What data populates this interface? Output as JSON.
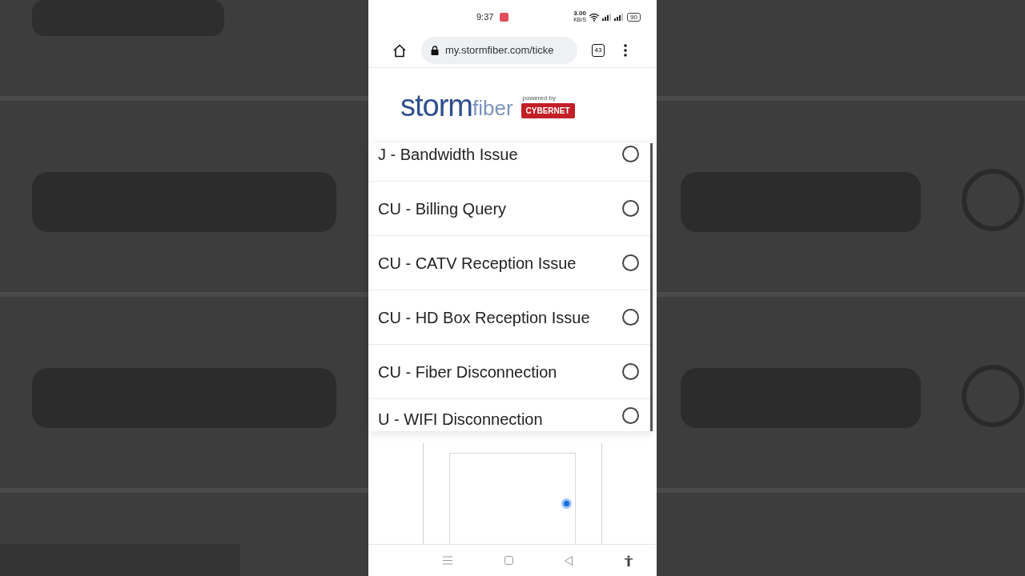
{
  "status_bar": {
    "time": "9:37",
    "network_speed": "3.00",
    "speed_unit": "KB/S",
    "battery": "90"
  },
  "browser": {
    "url": "my.stormfiber.com/ticke",
    "tab_count": "43"
  },
  "logo": {
    "brand": "storm",
    "suffix": "fiber",
    "powered_by": "powered by",
    "partner": "CYBERNET"
  },
  "options": [
    {
      "label": "J - Bandwidth Issue",
      "selected": false
    },
    {
      "label": "CU - Billing Query",
      "selected": false
    },
    {
      "label": "CU - CATV Reception Issue",
      "selected": false
    },
    {
      "label": "CU - HD Box Reception Issue",
      "selected": false
    },
    {
      "label": "CU - Fiber Disconnection",
      "selected": false
    },
    {
      "label": "U - WIFI Disconnection",
      "selected": false
    }
  ]
}
